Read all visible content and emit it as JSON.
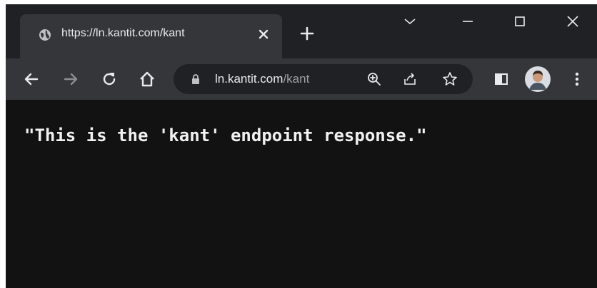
{
  "tab": {
    "title": "https://ln.kantit.com/kant",
    "favicon": "globe-icon"
  },
  "toolbar": {
    "back_icon": "arrow-left-icon",
    "forward_icon": "arrow-right-icon",
    "reload_icon": "reload-icon",
    "home_icon": "home-icon"
  },
  "omnibox": {
    "host": "ln.kantit.com",
    "path": "/kant"
  },
  "page": {
    "response": "\"This is the 'kant' endpoint response.\""
  },
  "colors": {
    "tabstrip_bg": "#202124",
    "toolbar_bg": "#35363a",
    "content_bg": "#121212",
    "text": "#e8eaed"
  }
}
